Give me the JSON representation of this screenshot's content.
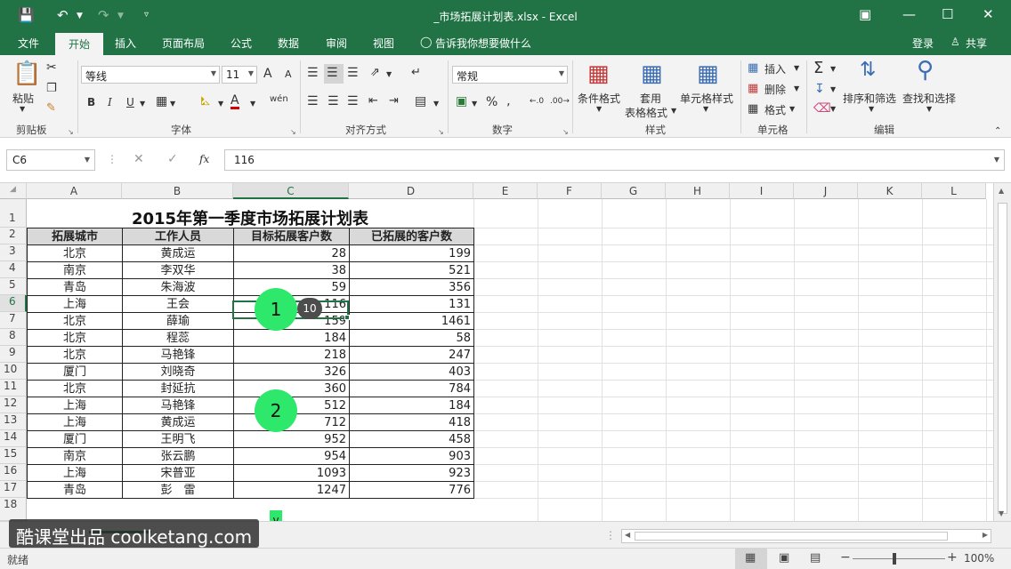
{
  "window": {
    "title": "_市场拓展计划表.xlsx - Excel",
    "login": "登录",
    "share": "共享"
  },
  "tabs": [
    "文件",
    "开始",
    "插入",
    "页面布局",
    "公式",
    "数据",
    "审阅",
    "视图"
  ],
  "tell_me": "告诉我你想要做什么",
  "ribbon": {
    "clipboard": {
      "paste": "粘贴",
      "label": "剪贴板"
    },
    "font": {
      "name": "等线",
      "size": "11",
      "grow": "A",
      "shrink": "A",
      "bold": "B",
      "italic": "I",
      "underline": "U",
      "color_a": "A",
      "phonetic": "wén",
      "label": "字体"
    },
    "alignment": {
      "label": "对齐方式"
    },
    "number": {
      "format": "常规",
      "percent": "%",
      "label": "数字"
    },
    "styles": {
      "conditional": "条件格式",
      "table_line1": "套用",
      "table_line2": "表格格式",
      "cell_styles": "单元格样式",
      "label": "样式"
    },
    "cells": {
      "insert": "插入",
      "delete": "删除",
      "format": "格式",
      "label": "单元格"
    },
    "editing": {
      "sort": "排序和筛选",
      "find": "查找和选择",
      "sum": "Σ",
      "label": "编辑"
    }
  },
  "formula_bar": {
    "name_box": "C6",
    "fx": "fx",
    "value": "116"
  },
  "columns": [
    "A",
    "B",
    "C",
    "D",
    "E",
    "F",
    "G",
    "H",
    "I",
    "J",
    "K",
    "L"
  ],
  "rows": [
    "1",
    "2",
    "3",
    "4",
    "5",
    "6",
    "7",
    "8",
    "9",
    "10",
    "11",
    "12",
    "13",
    "14",
    "15",
    "16",
    "17",
    "18"
  ],
  "sheet": {
    "title": "2015年第一季度市场拓展计划表",
    "headers": [
      "拓展城市",
      "工作人员",
      "目标拓展客户数",
      "已拓展的客户数"
    ],
    "data": [
      [
        "北京",
        "黄成运",
        "28",
        "199"
      ],
      [
        "南京",
        "李双华",
        "38",
        "521"
      ],
      [
        "青岛",
        "朱海波",
        "59",
        "356"
      ],
      [
        "上海",
        "王会",
        "116",
        "131"
      ],
      [
        "北京",
        "薛瑜",
        "159",
        "1461"
      ],
      [
        "北京",
        "程蕊",
        "184",
        "58"
      ],
      [
        "北京",
        "马艳锋",
        "218",
        "247"
      ],
      [
        "厦门",
        "刘晓奇",
        "326",
        "403"
      ],
      [
        "北京",
        "封延抗",
        "360",
        "784"
      ],
      [
        "上海",
        "马艳锋",
        "512",
        "184"
      ],
      [
        "上海",
        "黄成运",
        "712",
        "418"
      ],
      [
        "厦门",
        "王明飞",
        "952",
        "458"
      ],
      [
        "南京",
        "张云鹏",
        "954",
        "903"
      ],
      [
        "上海",
        "宋普亚",
        "1093",
        "923"
      ],
      [
        "青岛",
        "彭　雷",
        "1247",
        "776"
      ]
    ]
  },
  "overlay": {
    "step1": "1",
    "step2": "2",
    "badge": "10",
    "arrows": "v\nv\nv"
  },
  "status": {
    "ready": "就绪",
    "zoom": "100%"
  },
  "watermark": "酷课堂出品 coolketang.com",
  "colors": {
    "excel_green": "#217346",
    "highlight": "#2ee86b"
  }
}
